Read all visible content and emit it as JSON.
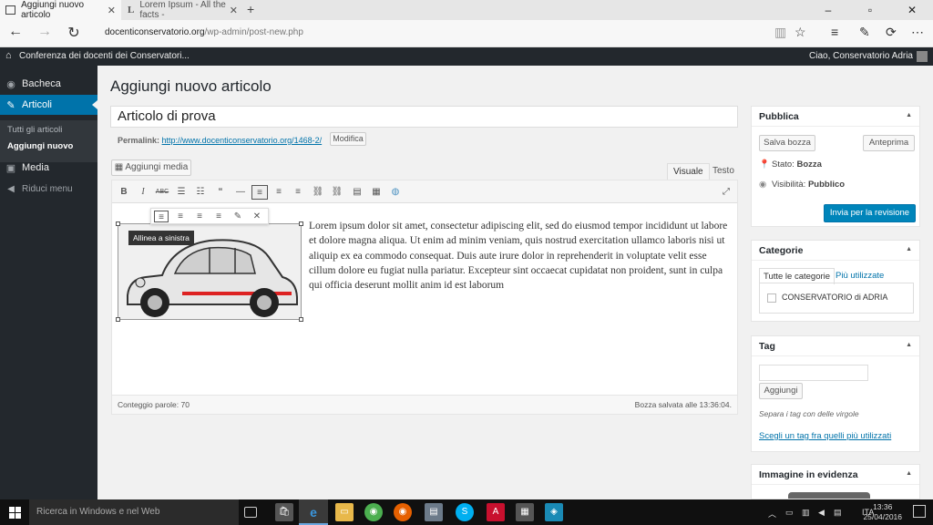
{
  "browser": {
    "tabs": [
      {
        "title": "Aggiungi nuovo articolo",
        "close": "✕"
      },
      {
        "title": "Lorem Ipsum - All the facts -",
        "close": "✕"
      }
    ],
    "new_tab": "+",
    "url_domain": "docenticonservatorio.org",
    "url_path": "/wp-admin/post-new.php"
  },
  "adminbar": {
    "site_name": "Conferenza dei docenti dei Conservatori...",
    "greeting": "Ciao, Conservatorio Adria"
  },
  "sidebar": {
    "items": [
      {
        "label": "Bacheca",
        "icon": "dashboard-icon"
      },
      {
        "label": "Articoli",
        "icon": "pin-icon"
      },
      {
        "label": "Media",
        "icon": "media-icon"
      }
    ],
    "submenu": [
      "Tutti gli articoli",
      "Aggiungi nuovo"
    ],
    "collapse": "Riduci menu"
  },
  "main": {
    "page_title": "Aggiungi nuovo articolo",
    "post_title": "Articolo di prova",
    "permalink_label": "Permalink:",
    "permalink_url": "http://www.docenticonservatorio.org/1468-2/",
    "modify_button": "Modifica",
    "add_media_button": "Aggiungi media",
    "tabs": [
      "Visuale",
      "Testo"
    ],
    "tooltip": "Allinea a sinistra",
    "body_text": "Lorem ipsum dolor sit amet, consectetur adipiscing elit, sed do eiusmod tempor incididunt ut labore et dolore magna aliqua. Ut enim ad minim veniam, quis nostrud exercitation ullamco laboris nisi ut aliquip ex ea commodo consequat. Duis aute irure dolor in reprehenderit in voluptate velit esse cillum dolore eu fugiat nulla pariatur. Excepteur sint occaecat cupidatat non proident, sunt in culpa qui officia deserunt mollit anim id est laborum",
    "word_count": "Conteggio parole: 70",
    "draft_saved": "Bozza salvata alle 13:36:04."
  },
  "publish_box": {
    "title": "Pubblica",
    "save_draft": "Salva bozza",
    "preview": "Anteprima",
    "status_label": "Stato:",
    "status_value": "Bozza",
    "visibility_label": "Visibilità:",
    "visibility_value": "Pubblico",
    "submit": "Invia per la revisione"
  },
  "categories_box": {
    "title": "Categorie",
    "tab_all": "Tutte le categorie",
    "tab_popular": "Più utilizzate",
    "items": [
      "CONSERVATORIO di ADRIA"
    ]
  },
  "tags_box": {
    "title": "Tag",
    "add_button": "Aggiungi",
    "hint": "Separa i tag con delle virgole",
    "choose_link": "Scegli un tag fra quelli più utilizzati"
  },
  "featured_box": {
    "title": "Immagine in evidenza"
  },
  "taskbar": {
    "search": "Ricerca in Windows e nel Web",
    "language": "ITA",
    "time": "13:36",
    "date": "25/04/2016"
  }
}
